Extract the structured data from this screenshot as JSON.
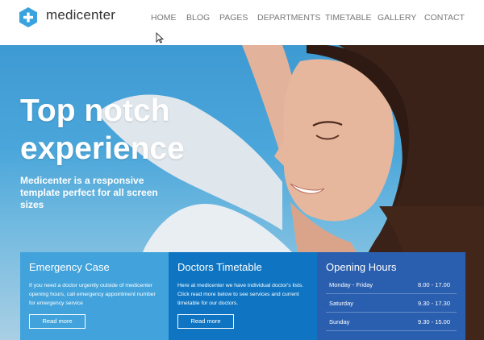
{
  "brand": {
    "name": "medicenter",
    "logo_icon": "medical-cross-hexagon-icon",
    "color": "#38a3df"
  },
  "nav": {
    "items": [
      {
        "label": "HOME"
      },
      {
        "label": "BLOG"
      },
      {
        "label": "PAGES"
      },
      {
        "label": "DEPARTMENTS"
      },
      {
        "label": "TIMETABLE"
      },
      {
        "label": "GALLERY"
      },
      {
        "label": "CONTACT"
      }
    ]
  },
  "hero": {
    "title": "Top notch experience",
    "subtitle": "Medicenter is a responsive template perfect for all screen sizes"
  },
  "boxes": {
    "emergency": {
      "title": "Emergency Case",
      "text": "If you need a doctor urgently outside of medicenter opening hours, call emergency appointment number for emergency service",
      "button": "Read more",
      "color": "#42a3dc"
    },
    "timetable": {
      "title": "Doctors Timetable",
      "text": "Here at medicenter we have individual doctor's lists. Click read more below to see services and current timetable for our doctors.",
      "button": "Read more",
      "color": "#0f75c2"
    },
    "hours": {
      "title": "Opening Hours",
      "color": "#2a5fb0",
      "rows": [
        {
          "day": "Monday - Friday",
          "time": "8.00 - 17.00"
        },
        {
          "day": "Saturday",
          "time": "9.30 - 17.30"
        },
        {
          "day": "Sunday",
          "time": "9.30 - 15.00"
        }
      ]
    }
  }
}
